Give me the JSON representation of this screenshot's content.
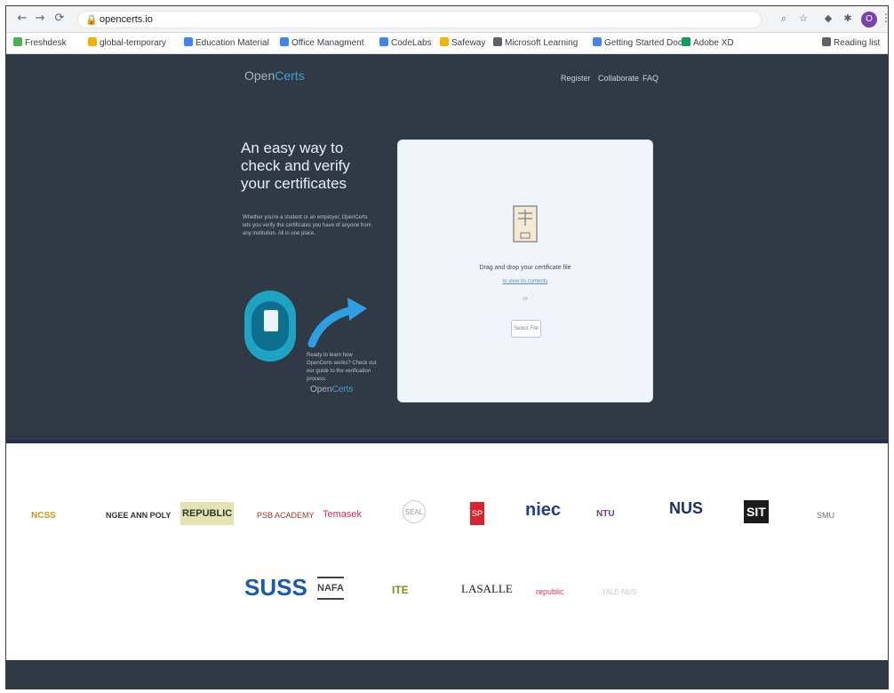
{
  "browser": {
    "url": "opencerts.io",
    "nav": {
      "back": "←",
      "forward": "→",
      "reload": "⟳"
    },
    "profile_initial": "O"
  },
  "bookmarks": [
    {
      "label": "Freshdesk",
      "color": "#4caf50"
    },
    {
      "label": "global-temporary",
      "color": "#f4b400"
    },
    {
      "label": "Education Material",
      "color": "#4285f4"
    },
    {
      "label": "Office Managment",
      "color": "#4285f4"
    },
    {
      "label": "CodeLabs",
      "color": "#4285f4"
    },
    {
      "label": "Safeway",
      "color": "#f4b400"
    },
    {
      "label": "Microsoft Learning",
      "color": "#5f6368"
    },
    {
      "label": "Getting Started Doc",
      "color": "#4285f4"
    },
    {
      "label": "Adobe XD",
      "color": "#0f9d58"
    },
    {
      "label": "Reading list",
      "color": "#5f6368"
    }
  ],
  "site": {
    "brand_prefix": "Open",
    "brand_suffix": "Certs",
    "nav": [
      "Register",
      "Collaborate",
      "FAQ"
    ],
    "headline": "An easy way to check and verify your certificates",
    "subtext": "Whether you're a student or an employer, OpenCerts lets you verify the certificates you have of anyone from any institution. All in one place.",
    "promo_text": "Ready to learn how OpenCerts works? Check out our guide to the verification process",
    "promo_brand_prefix": "Open",
    "promo_brand_suffix": "Certs"
  },
  "upload": {
    "drop_text": "Drag and drop your certificate file",
    "link_text": "to view its contents",
    "or_text": "or",
    "button_label": "Select File"
  },
  "partners_row1": [
    {
      "name": "NCSS",
      "text": "NCSS",
      "color": "#c79a1d"
    },
    {
      "name": "NP",
      "text": "NGEE ANN POLY",
      "color": "#333"
    },
    {
      "name": "REPUBLIC",
      "text": "REPUBLIC",
      "color": "#1f3d2b"
    },
    {
      "name": "PSB",
      "text": "PSB ACADEMY",
      "color": "#a13a2a"
    },
    {
      "name": "TEMASEK",
      "text": "Temasek",
      "color": "#d62d5a"
    },
    {
      "name": "SEAL",
      "text": "SEAL",
      "color": "#999"
    },
    {
      "name": "SP",
      "text": "SP",
      "color": "#d9232e"
    },
    {
      "name": "NIEC",
      "text": "niec",
      "color": "#1f3f8c"
    },
    {
      "name": "NTU",
      "text": "NTU",
      "color": "#6b3e7d"
    },
    {
      "name": "NUS",
      "text": "NUS",
      "color": "#1a2f6b"
    },
    {
      "name": "SIT",
      "text": "SIT",
      "color": "#1b1b1b"
    },
    {
      "name": "SMU",
      "text": "SMU",
      "color": "#6c6c6c"
    }
  ],
  "partners_row2": [
    {
      "name": "SUSS",
      "text": "SUSS",
      "color": "#1f5aa8"
    },
    {
      "name": "NAFA",
      "text": "NAFA",
      "color": "#444"
    },
    {
      "name": "ITE",
      "text": "ITE",
      "color": "#7a8f1a"
    },
    {
      "name": "LASALLE",
      "text": "LASALLE",
      "color": "#1a1a1a"
    },
    {
      "name": "RP",
      "text": "republic",
      "color": "#d63b5a"
    },
    {
      "name": "YALE",
      "text": "YALE-NUS",
      "color": "#c8c8c8"
    }
  ]
}
